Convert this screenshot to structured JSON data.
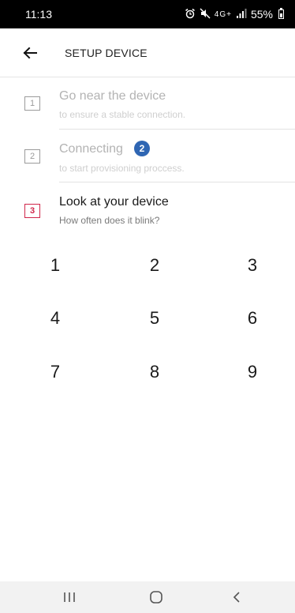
{
  "status_bar": {
    "time": "11:13",
    "icons": [
      "alarm-icon",
      "mute-icon",
      "4g-icon",
      "signal-icon"
    ],
    "network": "4G+",
    "battery": "55%"
  },
  "header": {
    "title": "SETUP DEVICE",
    "back_icon": "arrow-left-icon"
  },
  "steps": [
    {
      "number": "1",
      "title": "Go near the device",
      "subtitle": "to ensure a stable connection.",
      "state": "done"
    },
    {
      "number": "2",
      "title": "Connecting",
      "badge": "2",
      "subtitle": "to start provisioning proccess.",
      "state": "done"
    },
    {
      "number": "3",
      "title": "Look at your device",
      "subtitle": "How often does it blink?",
      "state": "active"
    }
  ],
  "keypad": [
    "1",
    "2",
    "3",
    "4",
    "5",
    "6",
    "7",
    "8",
    "9"
  ],
  "colors": {
    "active_accent": "#d0264a",
    "badge_blue": "#2f66b3",
    "inactive_text": "#b3b3b3"
  },
  "nav_bar": {
    "buttons": [
      "recent-apps-icon",
      "home-icon",
      "back-icon"
    ]
  }
}
